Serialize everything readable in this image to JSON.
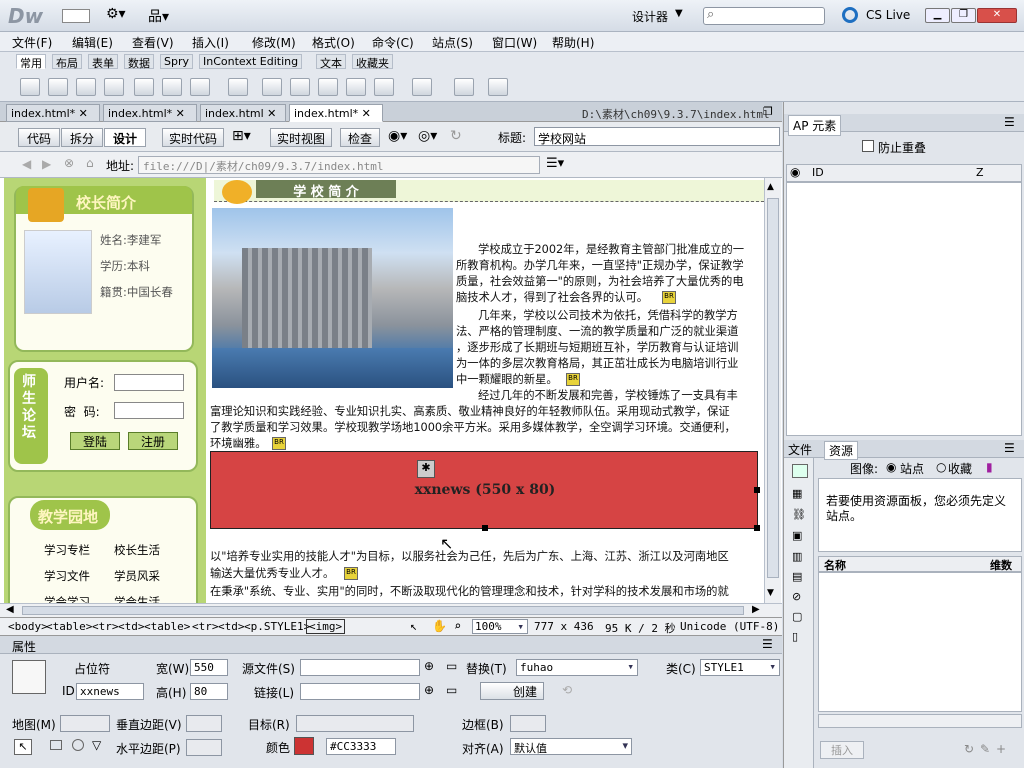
{
  "app": {
    "logo": "Dw",
    "workspace": "设计器",
    "search_placeholder": "",
    "cslive": "CS Live"
  },
  "menu": [
    "文件(F)",
    "编辑(E)",
    "查看(V)",
    "插入(I)",
    "修改(M)",
    "格式(O)",
    "命令(C)",
    "站点(S)",
    "窗口(W)",
    "帮助(H)"
  ],
  "insert_tabs": [
    "常用",
    "布局",
    "表单",
    "数据",
    "Spry",
    "InContext Editing",
    "文本",
    "收藏夹"
  ],
  "doc_tabs": [
    "index.html*",
    "index.html*",
    "index.html",
    "index.html*"
  ],
  "doc_path": "D:\\素材\\ch09\\9.3.7\\index.html",
  "view_buttons": {
    "code": "代码",
    "split": "拆分",
    "design": "设计",
    "live_code": "实时代码",
    "live_view": "实时视图",
    "inspect": "检查"
  },
  "title_label": "标题:",
  "title_value": "学校网站",
  "address_label": "地址:",
  "address_value": "file:///D|/素材/ch09/9.3.7/index.html",
  "page": {
    "principal_head": "校长简介",
    "principal": {
      "name": "姓名:李建军",
      "edu": "学历:本科",
      "origin": "籍贯:中国长春"
    },
    "forum_head": "师生论坛",
    "username_label": "用户名:",
    "password_label": "密  码:",
    "login": "登陆",
    "register": "注册",
    "garden_head": "教学园地",
    "garden_links": [
      "学习专栏",
      "校长生活",
      "学习文件",
      "学员风采",
      "学会学习",
      "学会生活"
    ],
    "intro_head": "学 校 简 介",
    "para1": [
      "学校成立于2002年，是经教育主管部门批准成立的一",
      "所教育机构。办学几年来，一直坚持\"正规办学，保证教学",
      "质量，社会效益第一\"的原则，为社会培养了大量优秀的电",
      "脑技术人才，得到了社会各界的认可。"
    ],
    "para2": [
      "几年来，学校以公司技术为依托，凭借科学的教学方",
      "法、严格的管理制度、一流的教学质量和广泛的就业渠道",
      "，逐步形成了长期班与短期班互补，学历教育与认证培训",
      "为一体的多层次教育格局，其正茁壮成长为电脑培训行业",
      "中一颗耀眼的新星。"
    ],
    "para3": [
      "经过几年的不断发展和完善，学校锤炼了一支具有丰",
      "富理论知识和实践经验、专业知识扎实、高素质、敬业精神良好的年轻教师队伍。采用现动式教学，保证",
      "了教学质量和学习效果。学校现教学场地1000余平方米。采用多媒体教学，全空调学习环境。交通便利，",
      "环境幽雅。"
    ],
    "flash_label": "xxnews (550 x 80)",
    "para4": [
      "以\"培养专业实用的技能人才\"为目标，以服务社会为己任，先后为广东、上海、江苏、浙江以及河南地区",
      "输送大量优秀专业人才。"
    ],
    "para5": "在秉承\"系统、专业、实用\"的同时，不断汲取现代化的管理理念和技术，针对学科的技术发展和市场的就"
  },
  "status": {
    "tags": [
      "<body>",
      "<table>",
      "<tr>",
      "<td>",
      "<table>",
      "<tr>",
      "<td>",
      "<p.STYLE1>",
      "<img>"
    ],
    "zoom": "100%",
    "size": "777 x 436",
    "weight": "95 K / 2 秒",
    "encoding": "Unicode (UTF-8)"
  },
  "props": {
    "header": "属性",
    "placeholder": "占位符",
    "id_label": "ID",
    "id_value": "xxnews",
    "w_label": "宽(W)",
    "w_value": "550",
    "h_label": "高(H)",
    "h_value": "80",
    "src_label": "源文件(S)",
    "link_label": "链接(L)",
    "alt_label": "替换(T)",
    "alt_value": "fuhao",
    "create": "创建",
    "class_label": "类(C)",
    "class_value": "STYLE1",
    "map_label": "地图(M)",
    "vspace_label": "垂直边距(V)",
    "hspace_label": "水平边距(P)",
    "target_label": "目标(R)",
    "border_label": "边框(B)",
    "color_label": "颜色",
    "color_value": "#CC3333",
    "align_label": "对齐(A)",
    "align_value": "默认值"
  },
  "ap": {
    "tab": "AP 元素",
    "prevent_overlap": "防止重叠",
    "col_id": "ID",
    "col_z": "Z"
  },
  "assets": {
    "tab_files": "文件",
    "tab_assets": "资源",
    "image_label": "图像:",
    "radio_site": "站点",
    "radio_fav": "收藏",
    "notice": "若要使用资源面板，您必须先定义站点。",
    "col_name": "名称",
    "col_dim": "维数",
    "insert": "插入"
  },
  "colors": {
    "flash": "#d64444",
    "leftbar": "#b8d675",
    "swatch": "#CC3333"
  }
}
